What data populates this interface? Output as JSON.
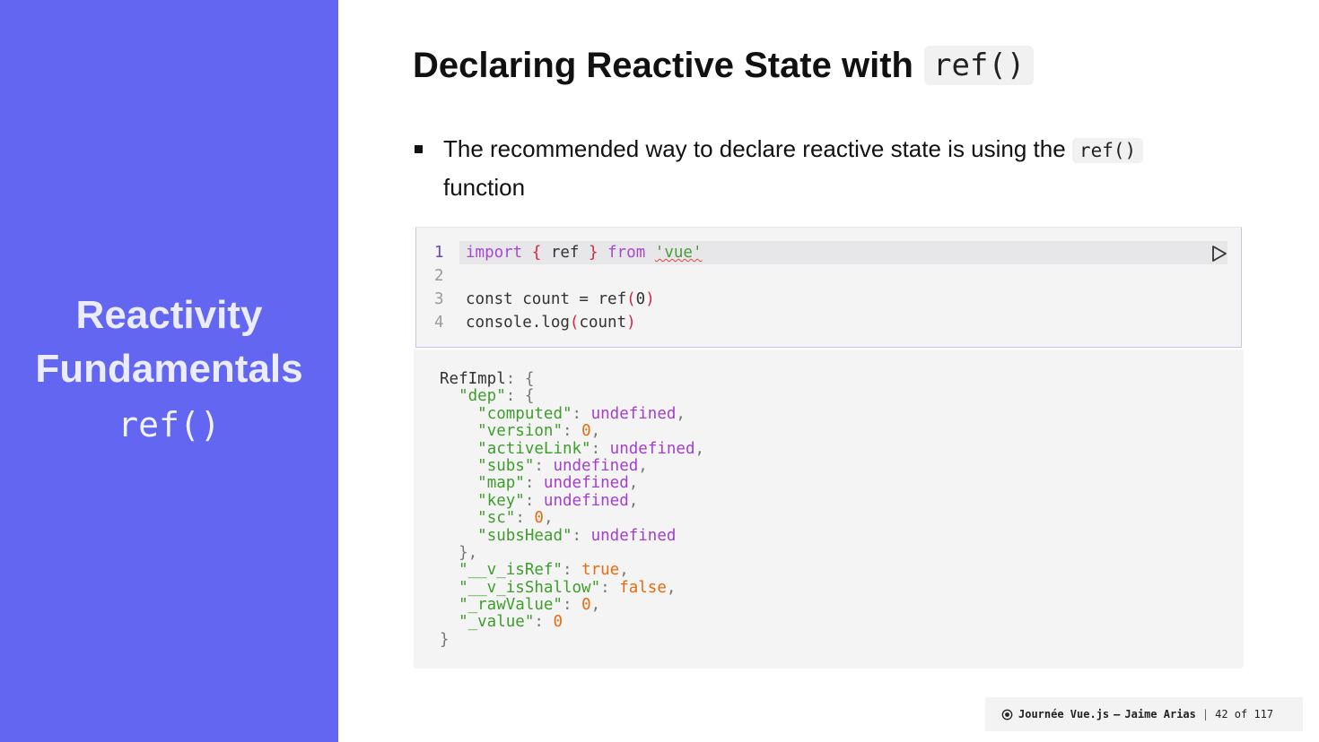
{
  "sidebar": {
    "line1": "Reactivity",
    "line2": "Fundamentals",
    "line3": "ref()"
  },
  "slide": {
    "title_text": "Declaring Reactive State with",
    "title_code": "ref()",
    "bullet_before": "The recommended way to declare reactive state is using the",
    "bullet_code": "ref()",
    "bullet_after": "function"
  },
  "editor": {
    "line_numbers": [
      "1",
      "2",
      "3",
      "4"
    ],
    "line1": {
      "import": "import",
      "ob": "{",
      "ref": " ref ",
      "cb": "}",
      "from": "from",
      "module": "'vue'"
    },
    "line3": {
      "before": "const count = ref",
      "op": "(",
      "num": "0",
      "cp": ")"
    },
    "line4": {
      "before": "console.log",
      "op": "(",
      "arg": "count",
      "cp": ")"
    },
    "run_icon": "play-icon"
  },
  "output": {
    "root": "RefImpl",
    "dep_key": "\"dep\"",
    "dep": [
      {
        "key": "\"computed\"",
        "value": "undefined",
        "kind": "undef",
        "comma": ","
      },
      {
        "key": "\"version\"",
        "value": "0",
        "kind": "num",
        "comma": ","
      },
      {
        "key": "\"activeLink\"",
        "value": "undefined",
        "kind": "undef",
        "comma": ","
      },
      {
        "key": "\"subs\"",
        "value": "undefined",
        "kind": "undef",
        "comma": ","
      },
      {
        "key": "\"map\"",
        "value": "undefined",
        "kind": "undef",
        "comma": ","
      },
      {
        "key": "\"key\"",
        "value": "undefined",
        "kind": "undef",
        "comma": ","
      },
      {
        "key": "\"sc\"",
        "value": "0",
        "kind": "num",
        "comma": ","
      },
      {
        "key": "\"subsHead\"",
        "value": "undefined",
        "kind": "undef",
        "comma": ""
      }
    ],
    "props": [
      {
        "key": "\"__v_isRef\"",
        "value": "true",
        "kind": "num",
        "comma": ","
      },
      {
        "key": "\"__v_isShallow\"",
        "value": "false",
        "kind": "num",
        "comma": ","
      },
      {
        "key": "\"_rawValue\"",
        "value": "0",
        "kind": "num",
        "comma": ","
      },
      {
        "key": "\"_value\"",
        "value": "0",
        "kind": "num",
        "comma": ""
      }
    ]
  },
  "footer": {
    "event": "Journée Vue.js",
    "dash": "–",
    "author": "Jaime Arias",
    "separator": "|",
    "page": "42 of 117"
  },
  "colors": {
    "sidebar_bg": "#6366f1",
    "keyword": "#a846d6",
    "string": "#3f9d2d",
    "number": "#ec6a0e"
  }
}
